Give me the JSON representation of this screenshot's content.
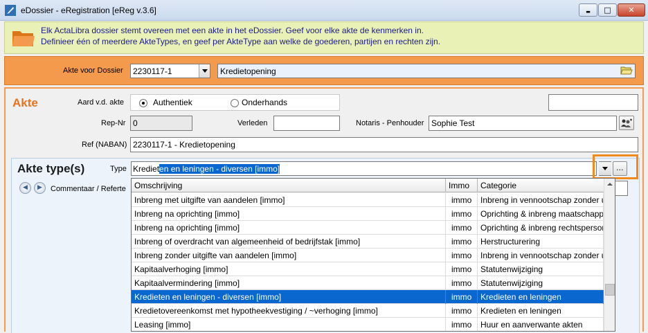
{
  "window": {
    "title": "eDossier - eRegistration [eReg v.3.6]",
    "buttons": {
      "minimize": "▬",
      "maximize": "□",
      "close": "✕"
    }
  },
  "banner": {
    "line1": "Elk ActaLibra dossier stemt overeen met een akte in het eDossier. Geef voor elke akte de kenmerken in.",
    "line2": "Definieer één of meerdere AkteTypes, en geef per AkteType aan welke de goederen, partijen en rechten zijn."
  },
  "dossier": {
    "label": "Akte voor Dossier",
    "dossier_value": "2230117-1",
    "description": "Kredietopening"
  },
  "akte": {
    "title": "Akte",
    "aard_label": "Aard v.d. akte",
    "radio_authentiek": "Authentiek",
    "radio_onderhands": "Onderhands",
    "selected": "Authentiek",
    "repnr_label": "Rep-Nr",
    "repnr_value": "0",
    "verleden_label": "Verleden",
    "verleden_value": "",
    "notaris_label": "Notaris - Penhouder",
    "notaris_value": "Sophie Test",
    "ref_label": "Ref (NABAN)",
    "ref_value": "2230117-1 - Kredietopening",
    "top_right_value": ""
  },
  "akte_types": {
    "title": "Akte type(s)",
    "type_label": "Type",
    "type_typed": "Krediet",
    "type_autocomplete": "en en leningen - diversen [immo]",
    "comment_label": "Commentaar / Referte"
  },
  "dropdown": {
    "columns": [
      "Omschrijving",
      "Immo",
      "Categorie"
    ],
    "rows": [
      {
        "omschrijving": "Inbreng met uitgifte van aandelen [immo]",
        "immo": "immo",
        "categorie": "Inbreng in vennootschap zonder uitgifte",
        "selected": false
      },
      {
        "omschrijving": "Inbreng na oprichting [immo]",
        "immo": "immo",
        "categorie": "Oprichting & inbreng maatschappen",
        "selected": false
      },
      {
        "omschrijving": "Inbreng na oprichting [immo]",
        "immo": "immo",
        "categorie": "Oprichting & inbreng rechtspersonen",
        "selected": false
      },
      {
        "omschrijving": "Inbreng of overdracht van algemeenheid of bedrijfstak [immo]",
        "immo": "immo",
        "categorie": "Herstructurering",
        "selected": false
      },
      {
        "omschrijving": "Inbreng zonder uitgifte van aandelen [immo]",
        "immo": "immo",
        "categorie": "Inbreng in vennootschap zonder uitgifte",
        "selected": false
      },
      {
        "omschrijving": "Kapitaalverhoging [immo]",
        "immo": "immo",
        "categorie": "Statutenwijziging",
        "selected": false
      },
      {
        "omschrijving": "Kapitaalvermindering [immo]",
        "immo": "immo",
        "categorie": "Statutenwijziging",
        "selected": false
      },
      {
        "omschrijving": "Kredieten en leningen - diversen [immo]",
        "immo": "immo",
        "categorie": "Kredieten en leningen",
        "selected": true
      },
      {
        "omschrijving": "Kredietovereenkomst met hypotheekvestiging / ~verhoging [immo]",
        "immo": "immo",
        "categorie": "Kredieten en leningen",
        "selected": false
      },
      {
        "omschrijving": "Leasing [immo]",
        "immo": "immo",
        "categorie": "Huur en aanverwante akten",
        "selected": false
      }
    ]
  },
  "colors": {
    "accent_orange": "#f39a4c",
    "title_orange": "#e8731e",
    "selection_blue": "#0a67cf",
    "banner_bg": "#e9f1b6"
  },
  "icons": {
    "app": "feather-app-icon",
    "banner": "folder-icon",
    "browse": "open-folder-icon",
    "notaris": "people-lookup-icon",
    "nav_prev": "previous-icon",
    "nav_next": "next-icon"
  }
}
